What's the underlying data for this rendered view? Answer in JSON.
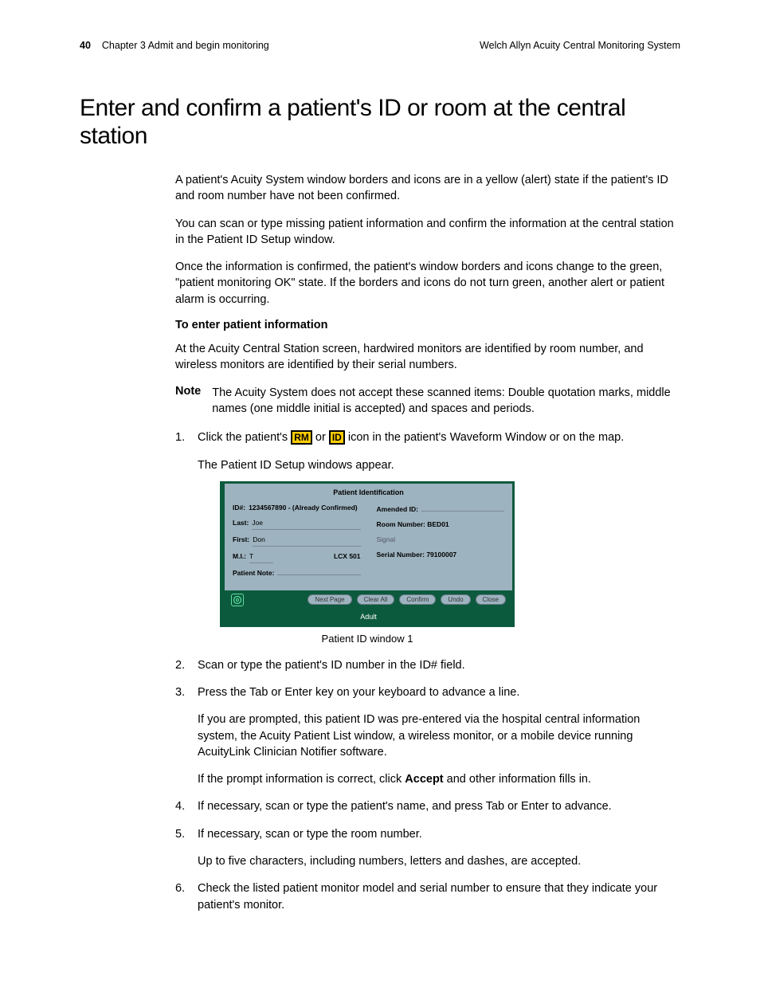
{
  "header": {
    "page_number": "40",
    "chapter": "Chapter 3  Admit and begin monitoring",
    "product": "Welch Allyn  Acuity Central Monitoring System"
  },
  "title": "Enter and confirm a patient's ID or room at the central station",
  "intro": {
    "p1": "A patient's Acuity System window borders and icons are in a yellow (alert) state if the patient's ID and room number have not been confirmed.",
    "p2": "You can scan or type missing patient information and confirm the information at the central station in the Patient ID Setup window.",
    "p3": "Once the information is confirmed, the patient's window borders and icons change to the green, \"patient monitoring OK\" state. If the borders and icons do not turn green, another alert or patient alarm is occurring."
  },
  "subheading": "To enter patient information",
  "sub_p": "At the Acuity Central Station screen, hardwired monitors are identified by room number, and wireless monitors are identified by their serial numbers.",
  "note": {
    "label": "Note",
    "text": "The Acuity System does not accept these scanned items: Double quotation marks, middle names (one middle initial is accepted) and spaces and periods."
  },
  "steps": {
    "s1a": "Click the patient's ",
    "s1_icon1": "RM",
    "s1b": " or ",
    "s1_icon2": "ID",
    "s1c": " icon in the patient's Waveform Window or on the map.",
    "s1_sub": "The Patient ID Setup windows appear.",
    "s2": "Scan or type the patient's ID number in the ID# field.",
    "s3": "Press the Tab or Enter key on your keyboard to advance a line.",
    "s3_sub1": "If you are prompted, this patient ID was pre-entered via the hospital central information system, the Acuity Patient List window, a wireless monitor, or a mobile device running AcuityLink Clinician Notifier software.",
    "s3_sub2a": "If the prompt information is correct, click ",
    "s3_sub2_bold": "Accept",
    "s3_sub2b": " and other information fills in.",
    "s4": "If necessary, scan or type the patient's name, and press Tab or Enter to advance.",
    "s5": "If necessary, scan or type the room number.",
    "s5_sub": "Up to five characters, including numbers, letters and dashes, are accepted.",
    "s6": "Check the listed patient monitor model and serial number to ensure that they indicate your patient's monitor."
  },
  "figure": {
    "caption": "Patient ID window 1",
    "window": {
      "title": "Patient Identification",
      "id_label": "ID#:",
      "id_value": "1234567890 - (Already Confirmed)",
      "amended_label": "Amended ID:",
      "amended_value": "",
      "last_label": "Last:",
      "last_value": "Joe",
      "room_label": "Room Number: BED01",
      "first_label": "First:",
      "first_value": "Don",
      "signal_label": "Signal",
      "mi_label": "M.I.:",
      "mi_value": "T",
      "model": "LCX 501",
      "serial_label": "Serial Number: 79100007",
      "patient_note_label": "Patient Note:",
      "buttons": {
        "next": "Next Page",
        "clear": "Clear All",
        "confirm": "Confirm",
        "undo": "Undo",
        "close": "Close"
      },
      "footer": "Adult"
    }
  }
}
